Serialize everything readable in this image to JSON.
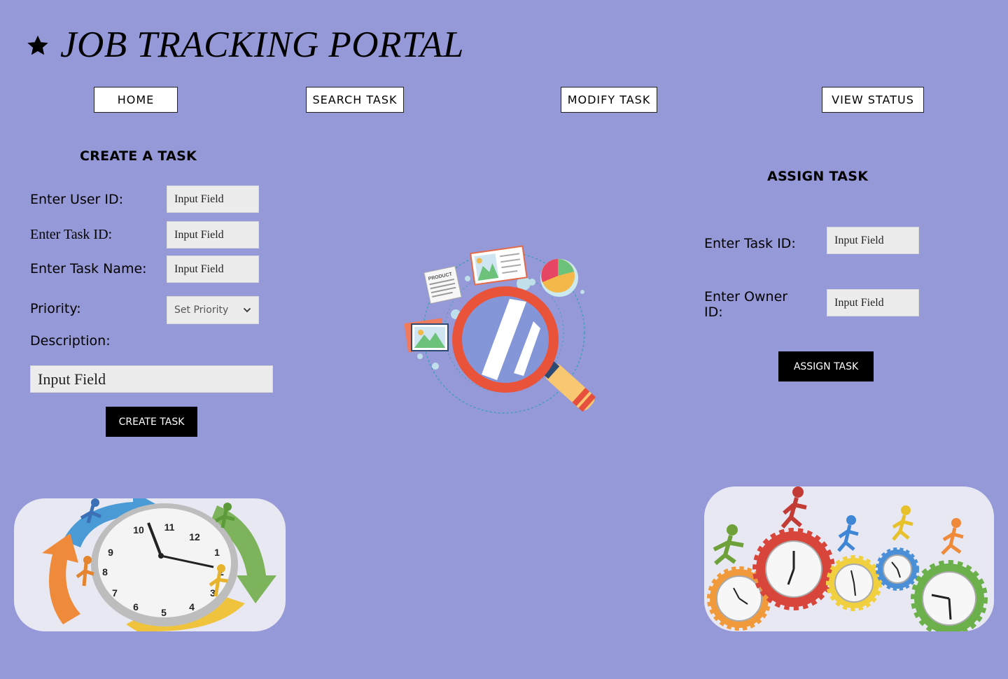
{
  "header": {
    "title": "JOB TRACKING PORTAL",
    "icon": "star-icon"
  },
  "nav": {
    "home": "HOME",
    "search_task": "SEARCH TASK",
    "modify_task": "MODIFY TASK",
    "view_status": "VIEW STATUS"
  },
  "create": {
    "title": "CREATE A TASK",
    "user_id_label": "Enter User ID:",
    "task_id_label": "Enter Task ID:",
    "task_name_label": "Enter Task Name:",
    "priority_label": "Priority:",
    "description_label": "Description:",
    "user_id_value": "Input Field",
    "task_id_value": "Input Field",
    "task_name_value": "Input Field",
    "priority_value": "Set Priority",
    "description_value": "Input Field",
    "button": "CREATE TASK"
  },
  "assign": {
    "title": "ASSIGN TASK",
    "task_id_label": "Enter Task ID:",
    "owner_label": "Enter Owner ID:",
    "task_id_value": "Input Field",
    "owner_value": "Input Field",
    "button": "ASSIGN TASK"
  },
  "colors": {
    "background": "#9699d8",
    "button": "#000000",
    "input": "#ececec"
  }
}
